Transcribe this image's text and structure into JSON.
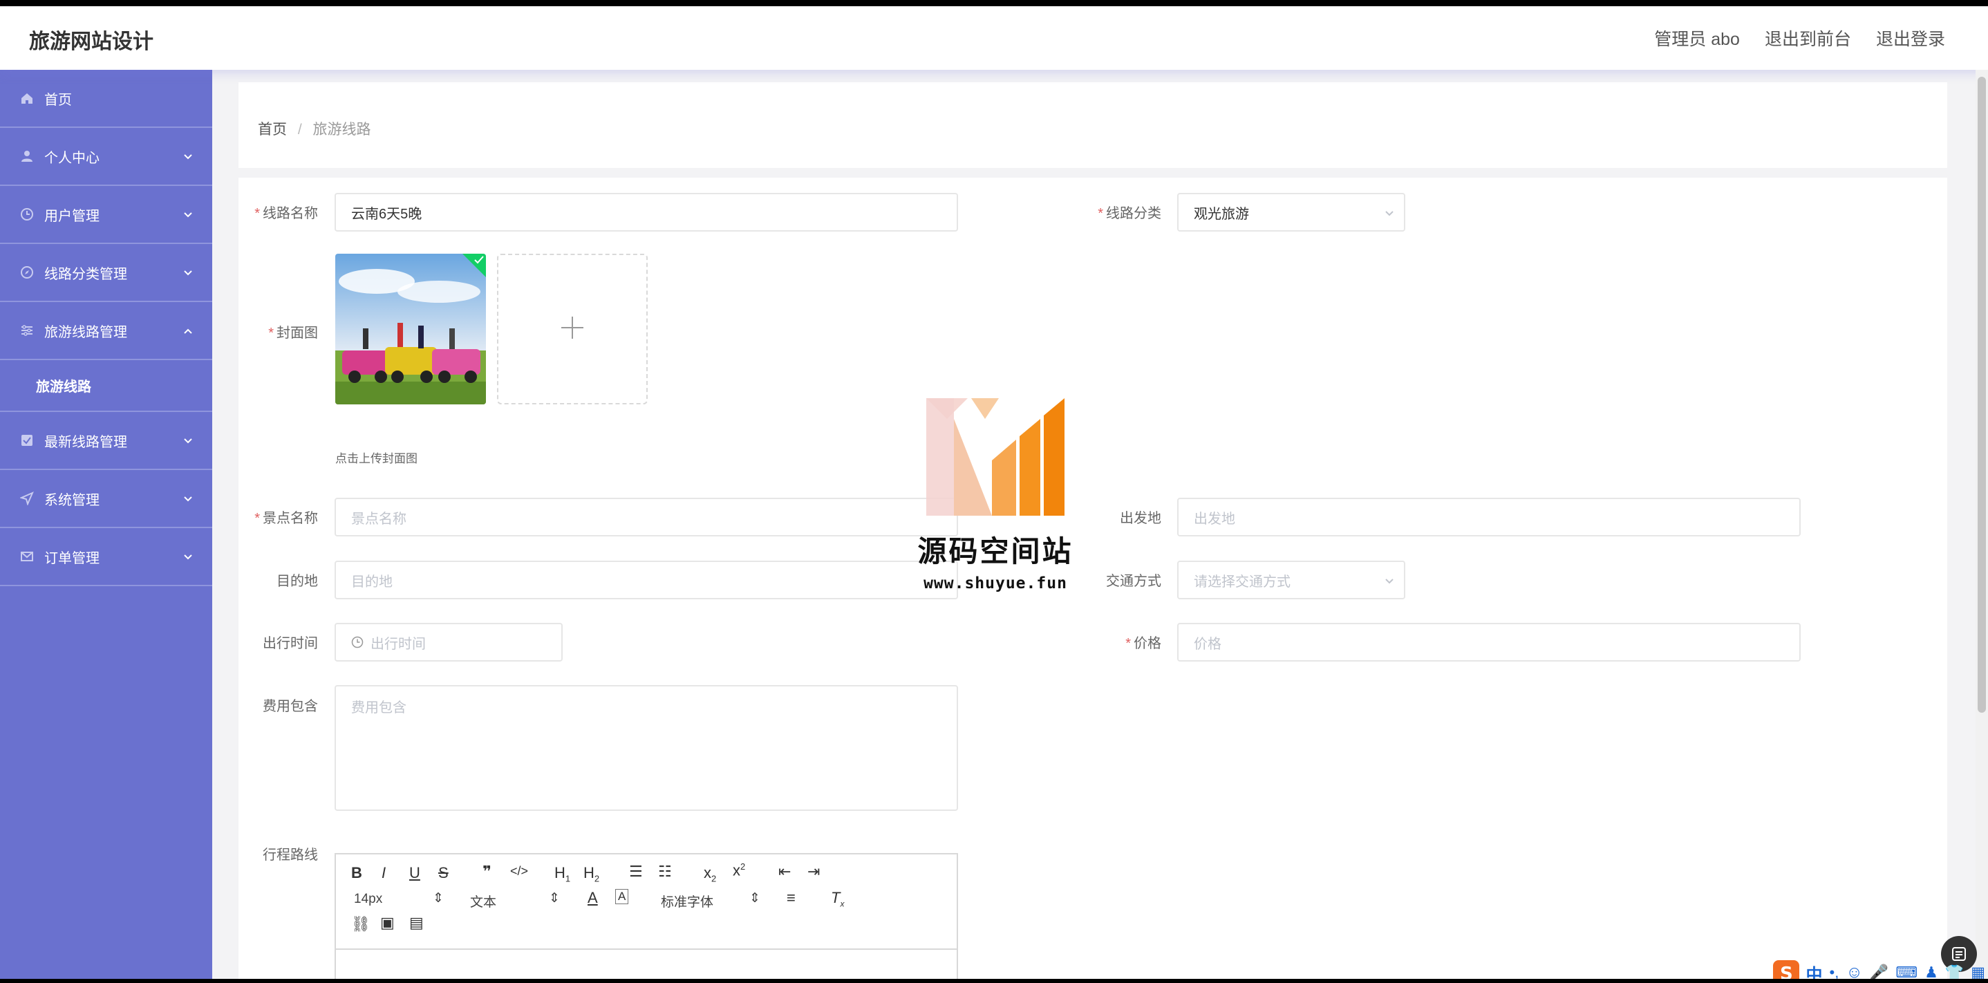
{
  "header": {
    "title": "旅游网站设计",
    "links": [
      "管理员 abo",
      "退出到前台",
      "退出登录"
    ]
  },
  "sidebar": {
    "items": [
      {
        "label": "首页",
        "icon": "home-icon"
      },
      {
        "label": "个人中心",
        "icon": "user-icon"
      },
      {
        "label": "用户管理",
        "icon": "clock-icon"
      },
      {
        "label": "线路分类管理",
        "icon": "compass-icon"
      },
      {
        "label": "旅游线路管理",
        "icon": "sliders-icon"
      },
      {
        "label": "最新线路管理",
        "icon": "checkbox-icon"
      },
      {
        "label": "系统管理",
        "icon": "send-icon"
      },
      {
        "label": "订单管理",
        "icon": "mail-icon"
      }
    ],
    "submenu": "旅游线路"
  },
  "breadcrumb": {
    "home": "首页",
    "separator": "/",
    "current": "旅游线路"
  },
  "form": {
    "route_name": {
      "label": "线路名称",
      "value": "云南6天5晚"
    },
    "category": {
      "label": "线路分类",
      "value": "观光旅游"
    },
    "cover": {
      "label": "封面图",
      "hint": "点击上传封面图"
    },
    "spot": {
      "label": "景点名称",
      "placeholder": "景点名称"
    },
    "departure": {
      "label": "出发地",
      "placeholder": "出发地"
    },
    "destination": {
      "label": "目的地",
      "placeholder": "目的地"
    },
    "transport": {
      "label": "交通方式",
      "placeholder": "请选择交通方式"
    },
    "depart_time": {
      "label": "出行时间",
      "placeholder": "出行时间"
    },
    "price": {
      "label": "价格",
      "placeholder": "价格"
    },
    "fee_includes": {
      "label": "费用包含",
      "placeholder": "费用包含"
    },
    "itinerary": {
      "label": "行程路线"
    }
  },
  "editor": {
    "font_size": "14px",
    "heading": "文本",
    "font_family": "标准字体"
  },
  "watermark": {
    "text": "源码空间站",
    "url": "www.shuyue.fun"
  },
  "colors": {
    "sidebar": "#6a71cf",
    "accent": "#f08c1e",
    "required": "#e06060"
  }
}
